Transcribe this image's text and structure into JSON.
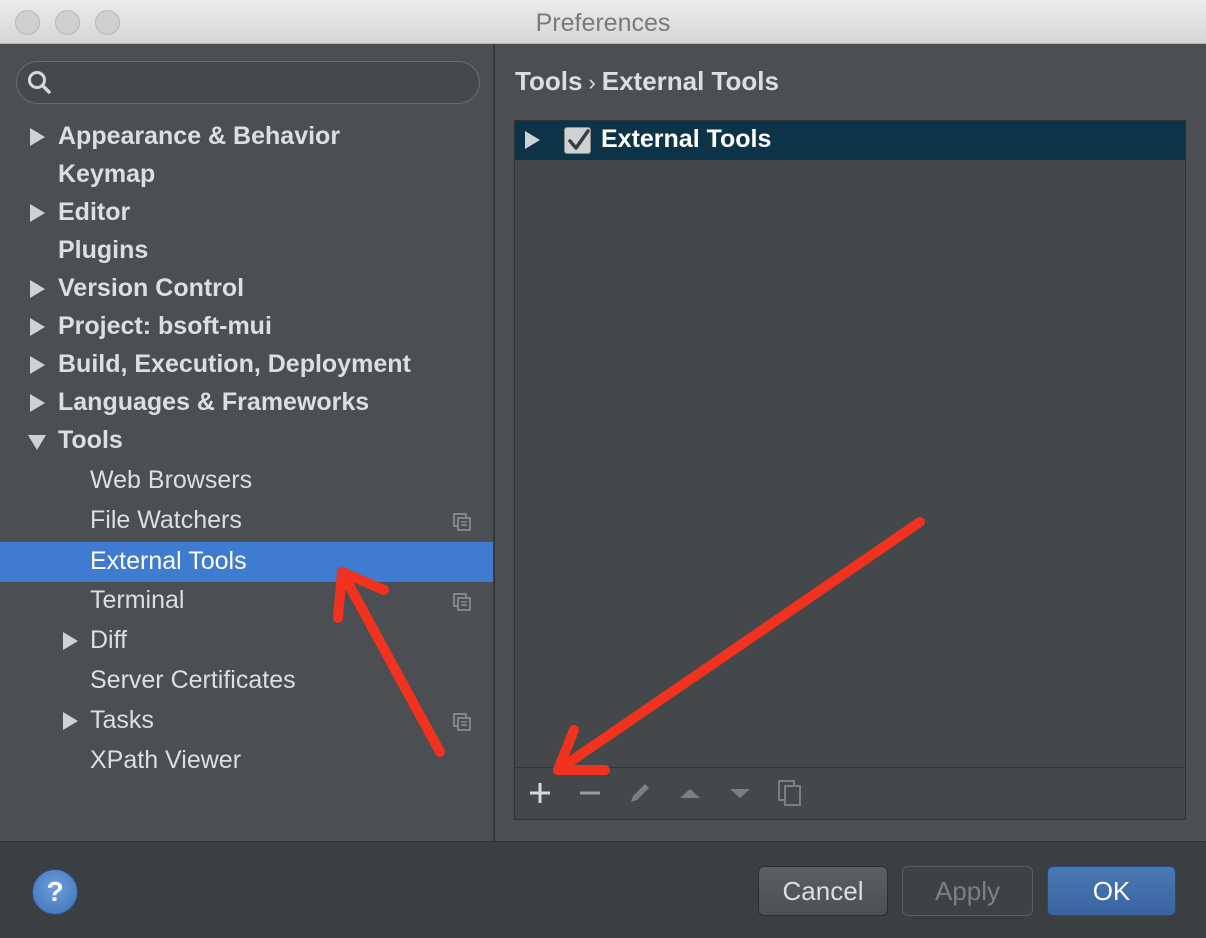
{
  "window": {
    "title": "Preferences"
  },
  "search": {
    "placeholder": "",
    "value": ""
  },
  "sidebar": {
    "items": [
      {
        "label": "Appearance & Behavior",
        "expander": "collapsed"
      },
      {
        "label": "Keymap",
        "expander": "none"
      },
      {
        "label": "Editor",
        "expander": "collapsed"
      },
      {
        "label": "Plugins",
        "expander": "none"
      },
      {
        "label": "Version Control",
        "expander": "collapsed"
      },
      {
        "label": "Project: bsoft-mui",
        "expander": "collapsed"
      },
      {
        "label": "Build, Execution, Deployment",
        "expander": "collapsed"
      },
      {
        "label": "Languages & Frameworks",
        "expander": "collapsed"
      },
      {
        "label": "Tools",
        "expander": "expanded"
      }
    ],
    "tools_children": [
      {
        "label": "Web Browsers",
        "expander": "none",
        "project_icon": false
      },
      {
        "label": "File Watchers",
        "expander": "none",
        "project_icon": true
      },
      {
        "label": "External Tools",
        "expander": "none",
        "project_icon": false,
        "selected": true
      },
      {
        "label": "Terminal",
        "expander": "none",
        "project_icon": true
      },
      {
        "label": "Diff",
        "expander": "collapsed",
        "project_icon": false
      },
      {
        "label": "Server Certificates",
        "expander": "none",
        "project_icon": false
      },
      {
        "label": "Tasks",
        "expander": "collapsed",
        "project_icon": true
      },
      {
        "label": "XPath Viewer",
        "expander": "none",
        "project_icon": false
      }
    ]
  },
  "breadcrumb": {
    "parent": "Tools",
    "separator": "›",
    "current": "External Tools"
  },
  "panel": {
    "group_label": "External Tools",
    "group_checked": true,
    "toolbar": [
      "add-icon",
      "remove-icon",
      "edit-icon",
      "move-up-icon",
      "move-down-icon",
      "copy-icon"
    ]
  },
  "footer": {
    "help_label": "?",
    "cancel_label": "Cancel",
    "apply_label": "Apply",
    "ok_label": "OK"
  },
  "colors": {
    "selection": "#3f7bd0",
    "panel_header": "#0d3349",
    "annotation_arrow": "#f0321e"
  }
}
